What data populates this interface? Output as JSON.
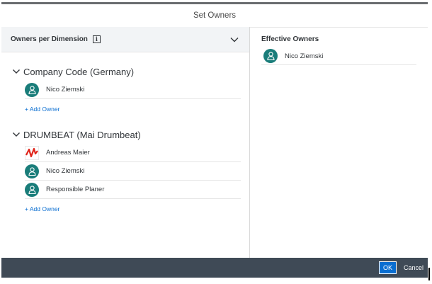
{
  "dialog": {
    "title": "Set Owners"
  },
  "left_panel": {
    "header": "Owners per Dimension",
    "info_glyph": "i",
    "groups": [
      {
        "label": "Company Code (Germany)",
        "owners": [
          {
            "name": "Nico Ziemski",
            "avatar": "person-icon"
          }
        ],
        "add_label": "+ Add Owner"
      },
      {
        "label": "DRUMBEAT (Mai Drumbeat)",
        "owners": [
          {
            "name": "Andreas Maier",
            "avatar": "photo"
          },
          {
            "name": "Nico Ziemski",
            "avatar": "person-icon"
          },
          {
            "name": "Responsible Planer",
            "avatar": "person-icon"
          }
        ],
        "add_label": "+ Add Owner"
      }
    ]
  },
  "right_panel": {
    "title": "Effective Owners",
    "owners": [
      {
        "name": "Nico Ziemski",
        "avatar": "person-icon"
      }
    ]
  },
  "footer": {
    "ok_label": "OK",
    "cancel_label": "Cancel"
  },
  "colors": {
    "accent": "#0a6ed1",
    "avatar": "#1a7d7a",
    "footer": "#3f4a56"
  }
}
